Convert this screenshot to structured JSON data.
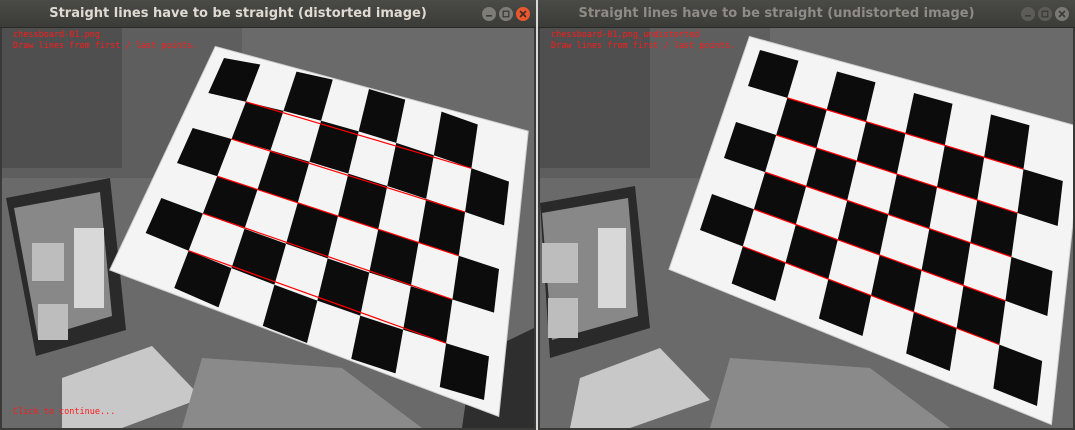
{
  "windows": {
    "left": {
      "title": "Straight lines have to be straight (distorted image)",
      "file_label": "chessboard-01.png",
      "hint_label": "Draw lines from first / last points.",
      "continue_label": "Click to continue..."
    },
    "right": {
      "title": "Straight lines have to be straight (undistorted image)",
      "file_label": "chessboard-01.png_undistorted",
      "hint_label": "Draw lines from first / last points."
    }
  },
  "icons": {
    "minimize": "minimize-icon",
    "maximize": "maximize-icon",
    "close": "close-icon"
  },
  "colors": {
    "overlay_text": "#ff1a1a",
    "guide_line": "#ff0000",
    "close_active": "#e9572f",
    "titlebar": "#3b3b38"
  }
}
